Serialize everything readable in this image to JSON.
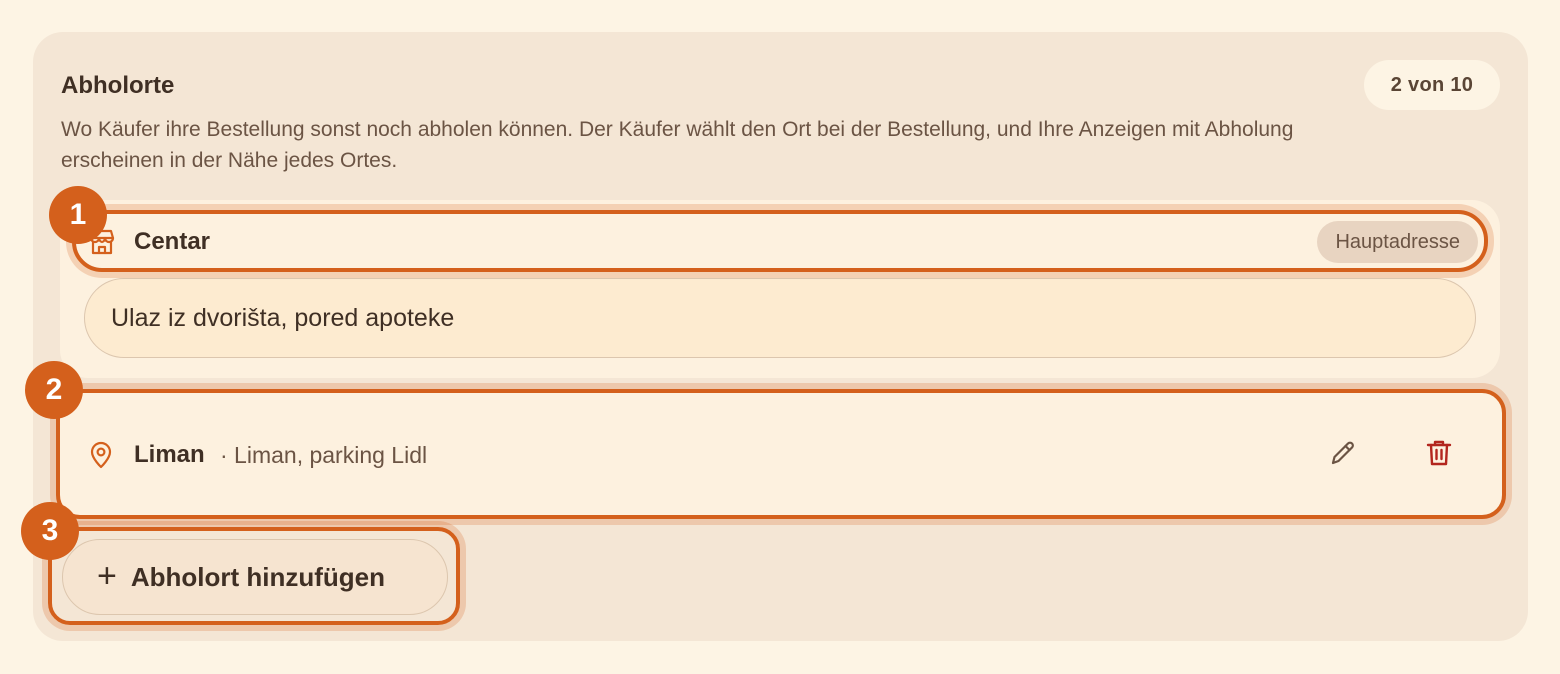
{
  "section": {
    "title": "Abholorte",
    "description": "Wo Käufer ihre Bestellung sonst noch abholen können. Der Käufer wählt den Ort bei der Bestellung, und Ihre Anzeigen mit Abholung erscheinen in der Nähe jedes Ortes.",
    "count_badge": "2 von 10"
  },
  "main_location": {
    "icon": "store-icon",
    "name": "Centar",
    "badge": "Hauptadresse",
    "note_value": "Ulaz iz dvorišta, pored apoteke"
  },
  "extra_location": {
    "icon": "map-pin-icon",
    "name": "Liman",
    "detail": "· Liman, parking Lidl",
    "edit_icon": "pencil-icon",
    "delete_icon": "trash-icon"
  },
  "add_button": {
    "icon": "plus-icon",
    "label": "Abholort hinzufügen"
  },
  "markers": [
    "1",
    "2",
    "3"
  ],
  "colors": {
    "accent": "#d4601c",
    "delete": "#b3261e",
    "panel": "#f4e6d5",
    "background": "#fdf4e4"
  }
}
